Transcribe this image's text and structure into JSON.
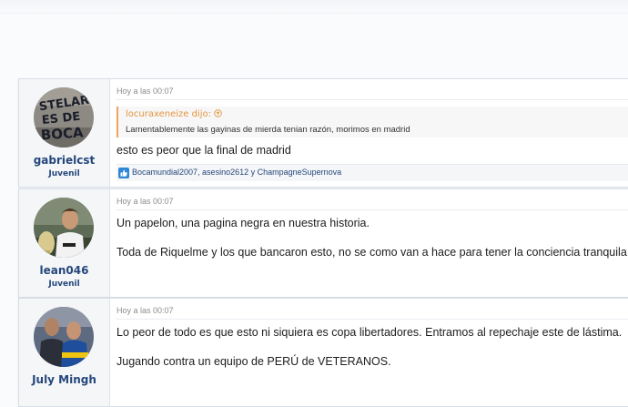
{
  "posts": [
    {
      "username": "gabrielcst",
      "rank": "Juvenil",
      "avatar_icon": "graffiti-wall-avatar",
      "date": "Hoy a las 00:07",
      "quote": {
        "author": "locuraxeneize dijo:",
        "text": "Lamentablemente las gayinas de mierda tenian razón, morimos en madrid"
      },
      "lines": [
        "esto es peor que la final de madrid"
      ],
      "likes": "Bocamundial2007, asesino2612 y ChampagneSupernova"
    },
    {
      "username": "lean046",
      "rank": "Juvenil",
      "avatar_icon": "player-photo-avatar",
      "date": "Hoy a las 00:07",
      "lines": [
        "Un papelon, una pagina negra en nuestra historia.",
        "Toda de Riquelme y los que bancaron esto, no se como van a hace para tener la conciencia tranquila."
      ]
    },
    {
      "username": "July Mingh",
      "rank": "",
      "avatar_icon": "players-photo-avatar",
      "date": "Hoy a las 00:07",
      "lines": [
        "Lo peor de todo es que esto ni siquiera es copa libertadores. Entramos al repechaje este de lástima.",
        "Jugando contra un equipo de PERÚ de VETERANOS."
      ]
    }
  ],
  "colors": {
    "username": "#24477b",
    "quote_accent": "#e3953f",
    "like_icon": "#2d86d6"
  }
}
